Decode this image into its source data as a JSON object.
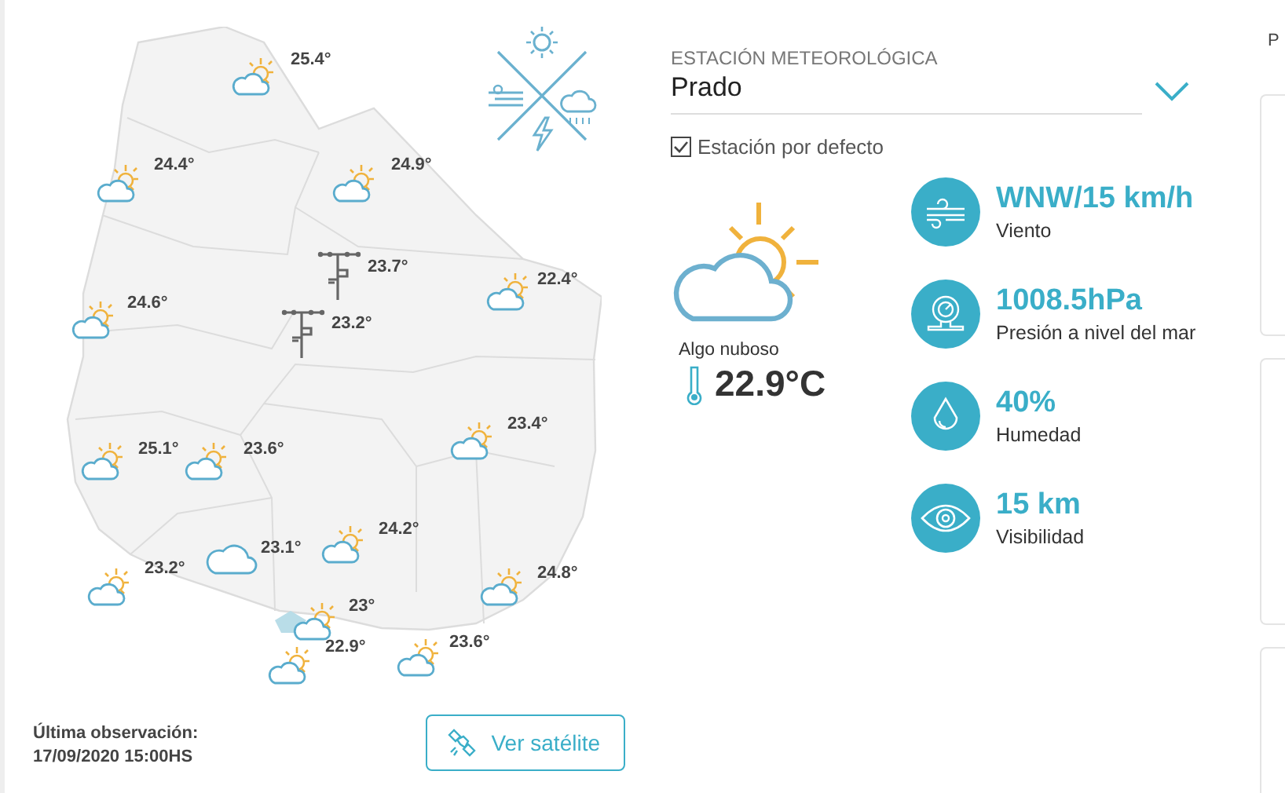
{
  "map": {
    "markers": [
      {
        "kind": "partly-cloudy",
        "temp": "25.4°"
      },
      {
        "kind": "partly-cloudy",
        "temp": "24.4°"
      },
      {
        "kind": "partly-cloudy",
        "temp": "24.9°"
      },
      {
        "kind": "partly-cloudy",
        "temp": "24.6°"
      },
      {
        "kind": "station",
        "temp": "23.7°"
      },
      {
        "kind": "station",
        "temp": "23.2°"
      },
      {
        "kind": "partly-cloudy",
        "temp": "22.4°"
      },
      {
        "kind": "partly-cloudy",
        "temp": "25.1°"
      },
      {
        "kind": "partly-cloudy",
        "temp": "23.6°"
      },
      {
        "kind": "partly-cloudy",
        "temp": "23.4°"
      },
      {
        "kind": "cloudy",
        "temp": "23.1°"
      },
      {
        "kind": "partly-cloudy",
        "temp": "24.2°"
      },
      {
        "kind": "partly-cloudy",
        "temp": "23.2°"
      },
      {
        "kind": "partly-cloudy",
        "temp": "24.8°"
      },
      {
        "kind": "partly-cloudy",
        "temp": "23°"
      },
      {
        "kind": "partly-cloudy",
        "temp": "22.9°"
      },
      {
        "kind": "partly-cloudy",
        "temp": "23.6°"
      }
    ]
  },
  "last_observation": {
    "label": "Última observación:",
    "value": "17/09/2020 15:00HS"
  },
  "satellite_button": {
    "label": "Ver satélite"
  },
  "station": {
    "label": "ESTACIÓN METEOROLÓGICA",
    "value": "Prado",
    "default_station": {
      "label": "Estación por defecto",
      "checked": true
    }
  },
  "current": {
    "condition": "Algo nuboso",
    "temperature": "22.9°C"
  },
  "readings": [
    {
      "kind": "wind",
      "value": "WNW/15 km/h",
      "label": "Viento"
    },
    {
      "kind": "pressure",
      "value": "1008.5hPa",
      "label": "Presión a nivel del mar"
    },
    {
      "kind": "humidity",
      "value": "40%",
      "label": "Humedad"
    },
    {
      "kind": "visibility",
      "value": "15 km",
      "label": "Visibilidad"
    }
  ],
  "side_panel": {
    "heading": "P"
  }
}
